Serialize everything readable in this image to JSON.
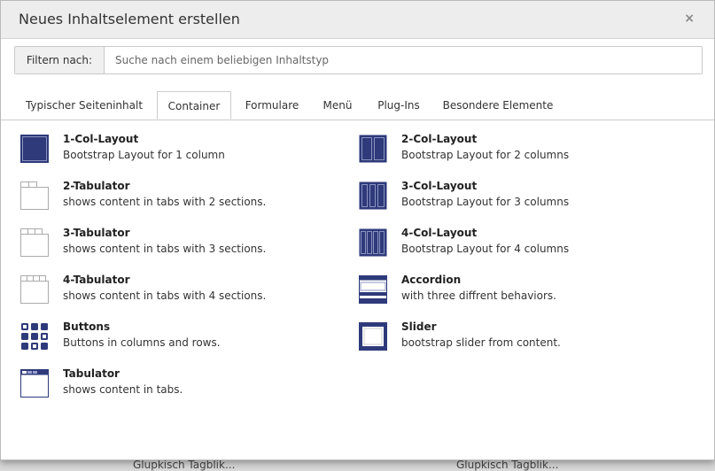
{
  "background_page": {
    "bottom_left_text": "Glupkisch Tagblik...",
    "bottom_right_text": "Glupkisch Tagblik..."
  },
  "modal": {
    "title": "Neues Inhaltselement erstellen",
    "close_symbol": "×"
  },
  "filter": {
    "label": "Filtern nach:",
    "placeholder": "Suche nach einem beliebigen Inhaltstyp",
    "value": ""
  },
  "tabs": [
    {
      "label": "Typischer Seiteninhalt",
      "active": false
    },
    {
      "label": "Container",
      "active": true
    },
    {
      "label": "Formulare",
      "active": false
    },
    {
      "label": "Menü",
      "active": false
    },
    {
      "label": "Plug-Ins",
      "active": false
    },
    {
      "label": "Besondere Elemente",
      "active": false
    }
  ],
  "items_left": [
    {
      "name": "1-Col-Layout",
      "desc": "Bootstrap Layout for 1 column",
      "icon": "one-col-layout-icon"
    },
    {
      "name": "2-Tabulator",
      "desc": "shows content in tabs with 2 sections.",
      "icon": "two-tab-icon"
    },
    {
      "name": "3-Tabulator",
      "desc": "shows content in tabs with 3 sections.",
      "icon": "three-tab-icon"
    },
    {
      "name": "4-Tabulator",
      "desc": "shows content in tabs with 4 sections.",
      "icon": "four-tab-icon"
    },
    {
      "name": "Buttons",
      "desc": "Buttons in columns and rows.",
      "icon": "buttons-grid-icon"
    },
    {
      "name": "Tabulator",
      "desc": "shows content in tabs.",
      "icon": "tabulator-icon"
    }
  ],
  "items_right": [
    {
      "name": "2-Col-Layout",
      "desc": "Bootstrap Layout for 2 columns",
      "icon": "two-col-layout-icon"
    },
    {
      "name": "3-Col-Layout",
      "desc": "Bootstrap Layout for 3 columns",
      "icon": "three-col-layout-icon"
    },
    {
      "name": "4-Col-Layout",
      "desc": "Bootstrap Layout for 4 columns",
      "icon": "four-col-layout-icon"
    },
    {
      "name": "Accordion",
      "desc": "with three diffrent behaviors.",
      "icon": "accordion-icon"
    },
    {
      "name": "Slider",
      "desc": "bootstrap slider from content.",
      "icon": "slider-icon"
    }
  ],
  "colors": {
    "icon_blue": "#2e3a7a",
    "header_bg": "#ededed"
  }
}
